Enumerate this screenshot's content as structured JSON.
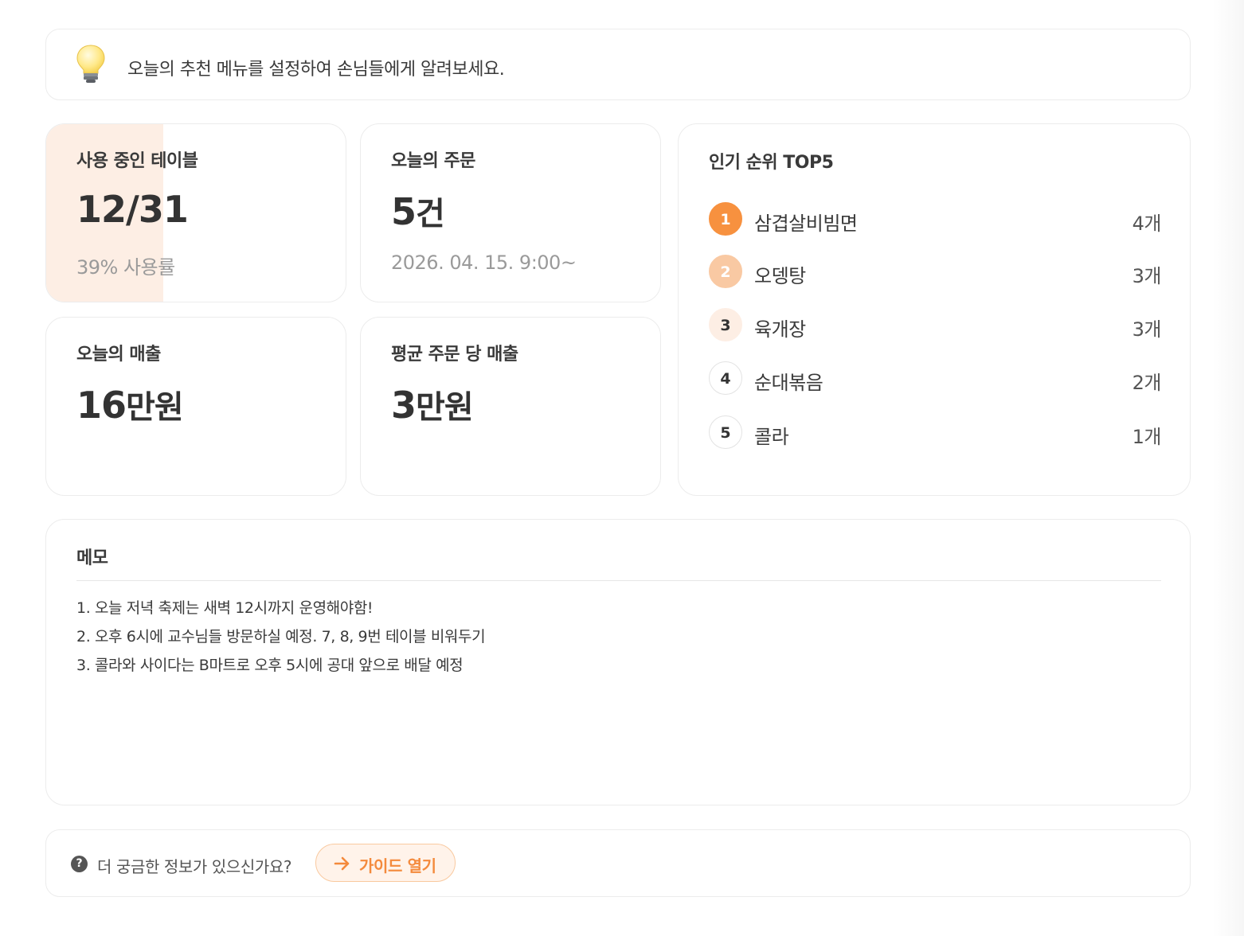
{
  "tip": {
    "icon": "lightbulb-icon",
    "text": "오늘의 추천 메뉴를 설정하여 손님들에게 알려보세요."
  },
  "stats": {
    "tables": {
      "title": "사용 중인 테이블",
      "value": "12/31",
      "sub": "39% 사용률",
      "usage_fraction": 0.39
    },
    "orders": {
      "title": "오늘의 주문",
      "value_number": "5",
      "value_unit": "건",
      "sub": "2026. 04. 15. 9:00~"
    },
    "sales": {
      "title": "오늘의 매출",
      "value_number": "16",
      "value_unit": "만원"
    },
    "avg": {
      "title": "평균 주문 당 매출",
      "value_number": "3",
      "value_unit": "만원"
    }
  },
  "top5": {
    "title": "인기 순위 TOP5",
    "items": [
      {
        "rank": "1",
        "name": "삼겹살비빔면",
        "count": "4개"
      },
      {
        "rank": "2",
        "name": "오뎅탕",
        "count": "3개"
      },
      {
        "rank": "3",
        "name": "육개장",
        "count": "3개"
      },
      {
        "rank": "4",
        "name": "순대볶음",
        "count": "2개"
      },
      {
        "rank": "5",
        "name": "콜라",
        "count": "1개"
      }
    ],
    "badge_colors": {
      "1": {
        "bg": "#f7913f",
        "fg": "#ffffff",
        "border": "#f7913f"
      },
      "2": {
        "bg": "#f9c9a3",
        "fg": "#ffffff",
        "border": "#f9c9a3"
      },
      "3": {
        "bg": "#fdeee4",
        "fg": "#333333",
        "border": "#fdeee4"
      },
      "4": {
        "bg": "#ffffff",
        "fg": "#333333",
        "border": "#e3e3e3"
      },
      "5": {
        "bg": "#ffffff",
        "fg": "#333333",
        "border": "#e3e3e3"
      }
    }
  },
  "memo": {
    "title": "메모",
    "lines": [
      "1. 오늘 저녁 축제는 새벽 12시까지 운영해야함!",
      "2. 오후 6시에 교수님들 방문하실 예정. 7, 8, 9번 테이블 비워두기",
      "3. 콜라와 사이다는 B마트로 오후 5시에 공대 앞으로 배달 예정"
    ]
  },
  "help": {
    "icon": "question-circle-icon",
    "text": "더 궁금한 정보가 있으신가요?",
    "button_label": "가이드 열기",
    "button_icon": "arrow-right-icon"
  },
  "colors": {
    "accent": "#f48a3c",
    "accent_light": "#fdeee4"
  }
}
